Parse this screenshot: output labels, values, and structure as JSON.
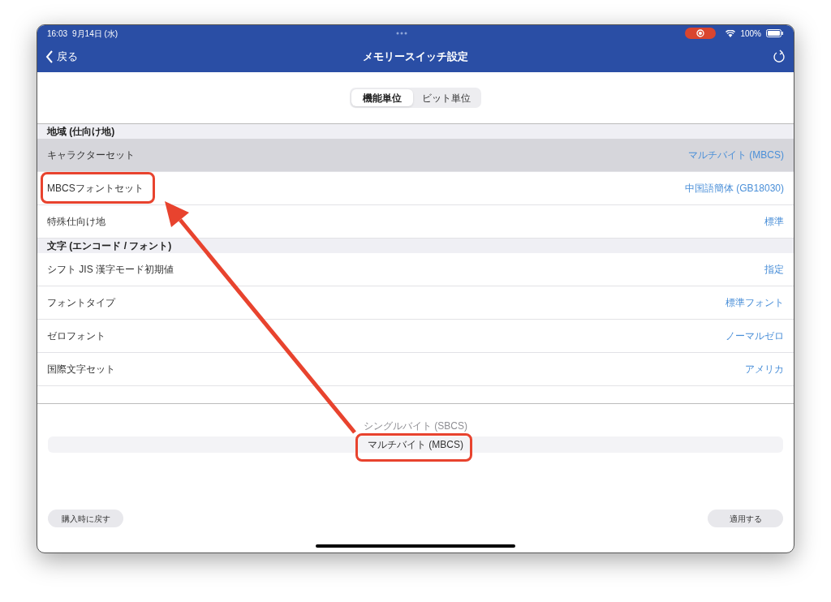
{
  "status_bar": {
    "time": "16:03",
    "date": "9月14日 (水)",
    "battery": "100%"
  },
  "nav_bar": {
    "back": "戻る",
    "title": "メモリースイッチ設定"
  },
  "segments": [
    {
      "label": "機能単位",
      "selected": true
    },
    {
      "label": "ビット単位",
      "selected": false
    }
  ],
  "sections": [
    {
      "title": "地域 (仕向け地)",
      "rows": [
        {
          "label": "キャラクターセット",
          "value": "マルチバイト (MBCS)",
          "selected": true
        },
        {
          "label": "MBCSフォントセット",
          "value": "中国語簡体 (GB18030)",
          "selected": false
        },
        {
          "label": "特殊仕向け地",
          "value": "標準",
          "selected": false
        }
      ]
    },
    {
      "title": "文字 (エンコード / フォント)",
      "rows": [
        {
          "label": "シフト JIS 漢字モード初期値",
          "value": "指定",
          "selected": false
        },
        {
          "label": "フォントタイプ",
          "value": "標準フォント",
          "selected": false
        },
        {
          "label": "ゼロフォント",
          "value": "ノーマルゼロ",
          "selected": false
        },
        {
          "label": "国際文字セット",
          "value": "アメリカ",
          "selected": false
        }
      ]
    }
  ],
  "picker": [
    {
      "label": "シングルバイト (SBCS)",
      "selected": false
    },
    {
      "label": "マルチバイト (MBCS)",
      "selected": true
    }
  ],
  "buttons": [
    {
      "label": "購入時に戻す"
    },
    {
      "label": "適用する"
    }
  ]
}
